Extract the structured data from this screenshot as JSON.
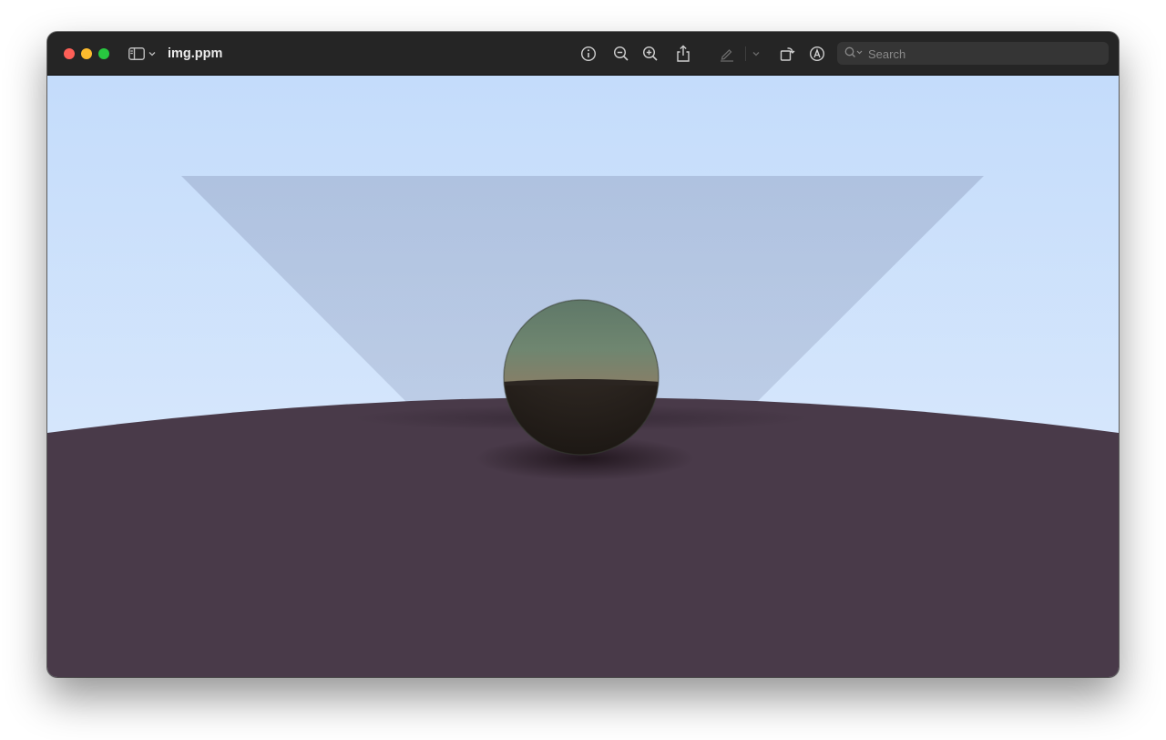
{
  "window": {
    "title": "img.ppm"
  },
  "toolbar": {
    "buttons": [
      {
        "name": "info-button",
        "icon": "info-icon"
      },
      {
        "name": "zoom-out-button",
        "icon": "zoom-out-icon"
      },
      {
        "name": "zoom-in-button",
        "icon": "zoom-in-icon"
      },
      {
        "name": "share-button",
        "icon": "share-icon"
      },
      {
        "name": "highlight-button",
        "icon": "pencil-icon"
      },
      {
        "name": "highlight-menu-button",
        "icon": "chevron-down-icon"
      },
      {
        "name": "rotate-button",
        "icon": "rotate-icon"
      },
      {
        "name": "markup-button",
        "icon": "markup-icon"
      }
    ]
  },
  "search": {
    "placeholder": "Search",
    "value": ""
  },
  "image": {
    "sky_top_color": "#c4dcfb",
    "sky_bottom_color": "#e1edfc",
    "ground_color": "#493a49",
    "panel_color": "#9fb0cf",
    "sphere_upper_color": "#6d8570",
    "sphere_lower_color": "#2b2521"
  }
}
